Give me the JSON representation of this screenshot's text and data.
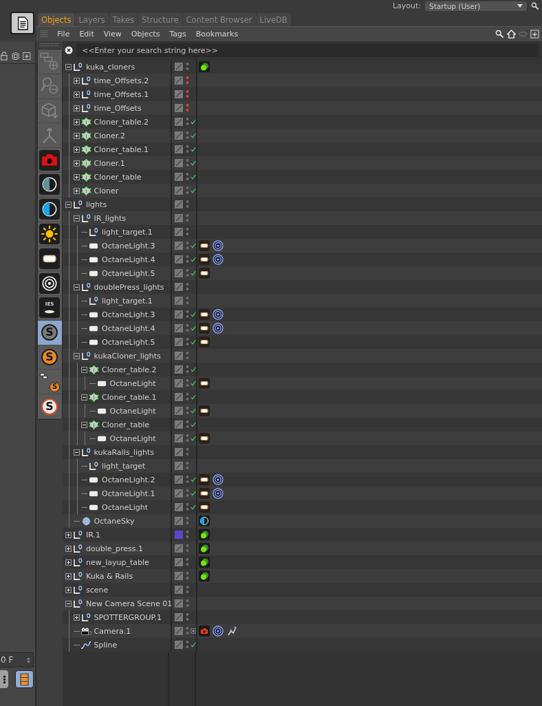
{
  "layout": {
    "label": "Layout:",
    "value": "Startup (User)"
  },
  "tabs": [
    {
      "label": "Objects",
      "selected": true
    },
    {
      "label": "Layers",
      "selected": false
    },
    {
      "label": "Takes",
      "selected": false
    },
    {
      "label": "Structure",
      "selected": false
    },
    {
      "label": "Content Browser",
      "selected": false
    },
    {
      "label": "LiveDB",
      "selected": false
    }
  ],
  "menu": [
    "File",
    "Edit",
    "View",
    "Objects",
    "Tags",
    "Bookmarks"
  ],
  "search": {
    "placeholder": "<<Enter your search string here>>"
  },
  "toolbar": [
    {
      "kind": "hierarchy",
      "selected": false
    },
    {
      "kind": "search",
      "selected": false
    },
    {
      "kind": "box",
      "selected": false
    },
    {
      "kind": "fork",
      "selected": false
    },
    {
      "kind": "camera",
      "selected": false
    },
    {
      "kind": "half",
      "color": "#5f9598",
      "selected": false
    },
    {
      "kind": "half",
      "color": "#15a4ec",
      "selected": false
    },
    {
      "kind": "sun",
      "selected": false
    },
    {
      "kind": "pill",
      "selected": false
    },
    {
      "kind": "rings",
      "selected": false
    },
    {
      "kind": "ies",
      "label": "IES",
      "selected": false
    },
    {
      "kind": "sign",
      "label": "S",
      "color": "#7a7a7a",
      "selected": true
    },
    {
      "kind": "sign",
      "label": "S",
      "color": "#ec8a2a",
      "selected": false
    },
    {
      "kind": "sign-tree",
      "label": "S",
      "color": "#ec8a2a",
      "selected": false
    },
    {
      "kind": "sign-ring",
      "label": "S",
      "color": "#e8e8e8",
      "selected": false
    }
  ],
  "objects": [
    {
      "name": "kuka_cloners",
      "kind": "null",
      "expanded": true,
      "hidden": false,
      "tags": [
        {
          "kind": "spheres"
        }
      ],
      "children": [
        {
          "name": "time_Offsets.2",
          "kind": "null",
          "expanded": false,
          "hidden": true
        },
        {
          "name": "time_Offsets.1",
          "kind": "null",
          "expanded": false,
          "hidden": true
        },
        {
          "name": "time_Offsets",
          "kind": "null",
          "expanded": false,
          "hidden": true
        },
        {
          "name": "Cloner_table.2",
          "kind": "cloner",
          "expanded": false,
          "hidden": false,
          "indicator": {
            "kind": "check"
          }
        },
        {
          "name": "Cloner.2",
          "kind": "cloner",
          "expanded": false,
          "hidden": false,
          "indicator": {
            "kind": "check"
          }
        },
        {
          "name": "Cloner_table.1",
          "kind": "cloner",
          "expanded": false,
          "hidden": false,
          "indicator": {
            "kind": "check"
          }
        },
        {
          "name": "Cloner.1",
          "kind": "cloner",
          "expanded": false,
          "hidden": false,
          "indicator": {
            "kind": "check"
          }
        },
        {
          "name": "Cloner_table",
          "kind": "cloner",
          "expanded": false,
          "hidden": false,
          "indicator": {
            "kind": "check"
          }
        },
        {
          "name": "Cloner",
          "kind": "cloner",
          "expanded": false,
          "hidden": false,
          "indicator": {
            "kind": "check"
          }
        }
      ]
    },
    {
      "name": "lights",
      "kind": "null",
      "expanded": true,
      "hidden": false,
      "children": [
        {
          "name": "IR_lights",
          "kind": "null",
          "expanded": true,
          "hidden": false,
          "children": [
            {
              "name": "light_target.1",
              "kind": "null",
              "hidden": false
            },
            {
              "name": "OctaneLight.3",
              "kind": "light",
              "hidden": false,
              "indicator": {
                "kind": "check"
              },
              "tags": [
                {
                  "kind": "light"
                },
                {
                  "kind": "target"
                }
              ]
            },
            {
              "name": "OctaneLight.4",
              "kind": "light",
              "hidden": false,
              "indicator": {
                "kind": "check"
              },
              "tags": [
                {
                  "kind": "light"
                },
                {
                  "kind": "target"
                }
              ]
            },
            {
              "name": "OctaneLight.5",
              "kind": "light",
              "hidden": false,
              "indicator": {
                "kind": "check"
              },
              "tags": [
                {
                  "kind": "light"
                }
              ]
            }
          ]
        },
        {
          "name": "doublePress_lights",
          "kind": "null",
          "expanded": true,
          "hidden": false,
          "children": [
            {
              "name": "light_target.1",
              "kind": "null",
              "hidden": false
            },
            {
              "name": "OctaneLight.3",
              "kind": "light",
              "hidden": false,
              "indicator": {
                "kind": "check"
              },
              "tags": [
                {
                  "kind": "light"
                },
                {
                  "kind": "target"
                }
              ]
            },
            {
              "name": "OctaneLight.4",
              "kind": "light",
              "hidden": false,
              "indicator": {
                "kind": "check"
              },
              "tags": [
                {
                  "kind": "light"
                },
                {
                  "kind": "target"
                }
              ]
            },
            {
              "name": "OctaneLight.5",
              "kind": "light",
              "hidden": false,
              "indicator": {
                "kind": "check"
              },
              "tags": [
                {
                  "kind": "light"
                }
              ]
            }
          ]
        },
        {
          "name": "kukaCloner_lights",
          "kind": "null",
          "expanded": true,
          "hidden": false,
          "children": [
            {
              "name": "Cloner_table.2",
              "kind": "cloner",
              "expanded": true,
              "hidden": false,
              "indicator": {
                "kind": "check"
              },
              "children": [
                {
                  "name": "OctaneLight",
                  "kind": "light",
                  "hidden": false,
                  "indicator": {
                    "kind": "check"
                  },
                  "tags": [
                    {
                      "kind": "light"
                    }
                  ]
                }
              ]
            },
            {
              "name": "Cloner_table.1",
              "kind": "cloner",
              "expanded": true,
              "hidden": false,
              "indicator": {
                "kind": "check"
              },
              "children": [
                {
                  "name": "OctaneLight",
                  "kind": "light",
                  "hidden": false,
                  "indicator": {
                    "kind": "check"
                  },
                  "tags": [
                    {
                      "kind": "light"
                    }
                  ]
                }
              ]
            },
            {
              "name": "Cloner_table",
              "kind": "cloner",
              "expanded": true,
              "hidden": false,
              "indicator": {
                "kind": "check"
              },
              "children": [
                {
                  "name": "OctaneLight",
                  "kind": "light",
                  "hidden": false,
                  "indicator": {
                    "kind": "check"
                  },
                  "tags": [
                    {
                      "kind": "light"
                    }
                  ]
                }
              ]
            }
          ]
        },
        {
          "name": "kukaRails_lights",
          "kind": "null",
          "expanded": true,
          "hidden": false,
          "children": [
            {
              "name": "light_target",
              "kind": "null",
              "hidden": false
            },
            {
              "name": "OctaneLight.2",
              "kind": "light",
              "hidden": false,
              "indicator": {
                "kind": "check"
              },
              "tags": [
                {
                  "kind": "light"
                },
                {
                  "kind": "target"
                }
              ]
            },
            {
              "name": "OctaneLight.1",
              "kind": "light",
              "hidden": false,
              "indicator": {
                "kind": "check"
              },
              "tags": [
                {
                  "kind": "light"
                },
                {
                  "kind": "target"
                }
              ]
            },
            {
              "name": "OctaneLight",
              "kind": "light",
              "hidden": false,
              "indicator": {
                "kind": "check"
              },
              "tags": [
                {
                  "kind": "light"
                }
              ]
            }
          ]
        },
        {
          "name": "OctaneSky",
          "kind": "sky",
          "hidden": false,
          "tags": [
            {
              "kind": "sky"
            }
          ]
        }
      ]
    },
    {
      "name": "IR.1",
      "kind": "null",
      "expanded": false,
      "hidden": false,
      "color": "#5a48c8",
      "tags": [
        {
          "kind": "spheres"
        }
      ]
    },
    {
      "name": "double_press.1",
      "kind": "null",
      "expanded": false,
      "hidden": false,
      "tags": [
        {
          "kind": "spheres"
        }
      ]
    },
    {
      "name": "new_layup_table",
      "kind": "null",
      "expanded": false,
      "hidden": false,
      "tags": [
        {
          "kind": "spheres"
        }
      ]
    },
    {
      "name": "Kuka & Rails",
      "kind": "null",
      "expanded": false,
      "hidden": false,
      "tags": [
        {
          "kind": "spheres"
        }
      ]
    },
    {
      "name": "scene",
      "kind": "null",
      "expanded": false,
      "hidden": false
    },
    {
      "name": "New Camera Scene 01",
      "kind": "null",
      "expanded": true,
      "hidden": false,
      "children": [
        {
          "name": "SPOTTERGROUP.1",
          "kind": "null",
          "expanded": false,
          "hidden": false
        },
        {
          "name": "Camera.1",
          "kind": "camera",
          "hidden": false,
          "indicator": {
            "kind": "frame"
          },
          "tags": [
            {
              "kind": "camera"
            },
            {
              "kind": "target"
            },
            {
              "kind": "figure"
            }
          ]
        },
        {
          "name": "Spline",
          "kind": "spline",
          "hidden": false,
          "indicator": {
            "kind": "check"
          }
        }
      ]
    }
  ],
  "timeline": {
    "frame": "0 F"
  }
}
